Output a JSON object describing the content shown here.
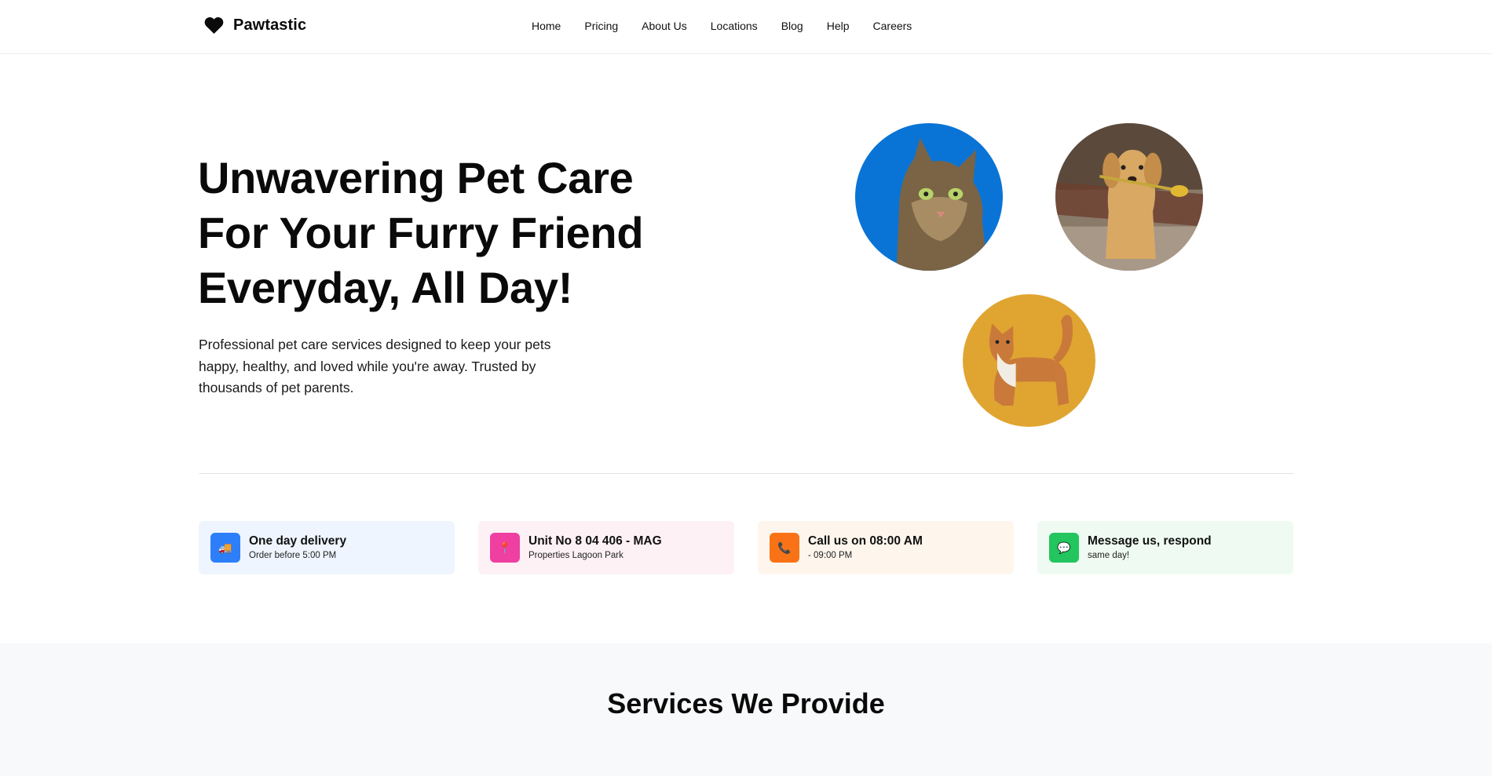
{
  "brand": {
    "name": "Pawtastic",
    "icon": "heart-icon"
  },
  "nav": {
    "items": [
      {
        "label": "Home"
      },
      {
        "label": "Pricing"
      },
      {
        "label": "About Us"
      },
      {
        "label": "Locations"
      },
      {
        "label": "Blog"
      },
      {
        "label": "Help"
      },
      {
        "label": "Careers"
      }
    ]
  },
  "hero": {
    "title_lines": [
      "Unwavering Pet Care",
      "For Your Furry Friend",
      "Everyday, All Day!"
    ],
    "subtitle_lines": [
      "Professional pet care services designed to keep your pets",
      "happy, healthy, and loved while you're away. Trusted by",
      "thousands of pet parents."
    ],
    "images": [
      {
        "subject": "tabby-cat-photo",
        "background": "#0a74d6"
      },
      {
        "subject": "golden-retriever-photo",
        "background": "#6b5a4a"
      },
      {
        "subject": "orange-cat-photo",
        "background": "#e0a531"
      }
    ]
  },
  "info_cards": [
    {
      "icon": "truck-icon",
      "icon_bg": "#2d7ff9",
      "card_bg": "#eef5fe",
      "title": "One day delivery",
      "subtitle": "Order before 5:00 PM"
    },
    {
      "icon": "pin-icon",
      "icon_bg": "#ef3fa1",
      "card_bg": "#fdf1f6",
      "title": "Unit No 8 04 406 - MAG",
      "subtitle": "Properties Lagoon Park"
    },
    {
      "icon": "phone-icon",
      "icon_bg": "#f97316",
      "card_bg": "#fef6ec",
      "title": "Call us on 08:00 AM",
      "subtitle": "- 09:00 PM"
    },
    {
      "icon": "chat-icon",
      "icon_bg": "#22c55e",
      "card_bg": "#effbf2",
      "title": "Message us, respond",
      "subtitle": "same day!"
    }
  ],
  "services": {
    "heading": "Services We Provide"
  }
}
